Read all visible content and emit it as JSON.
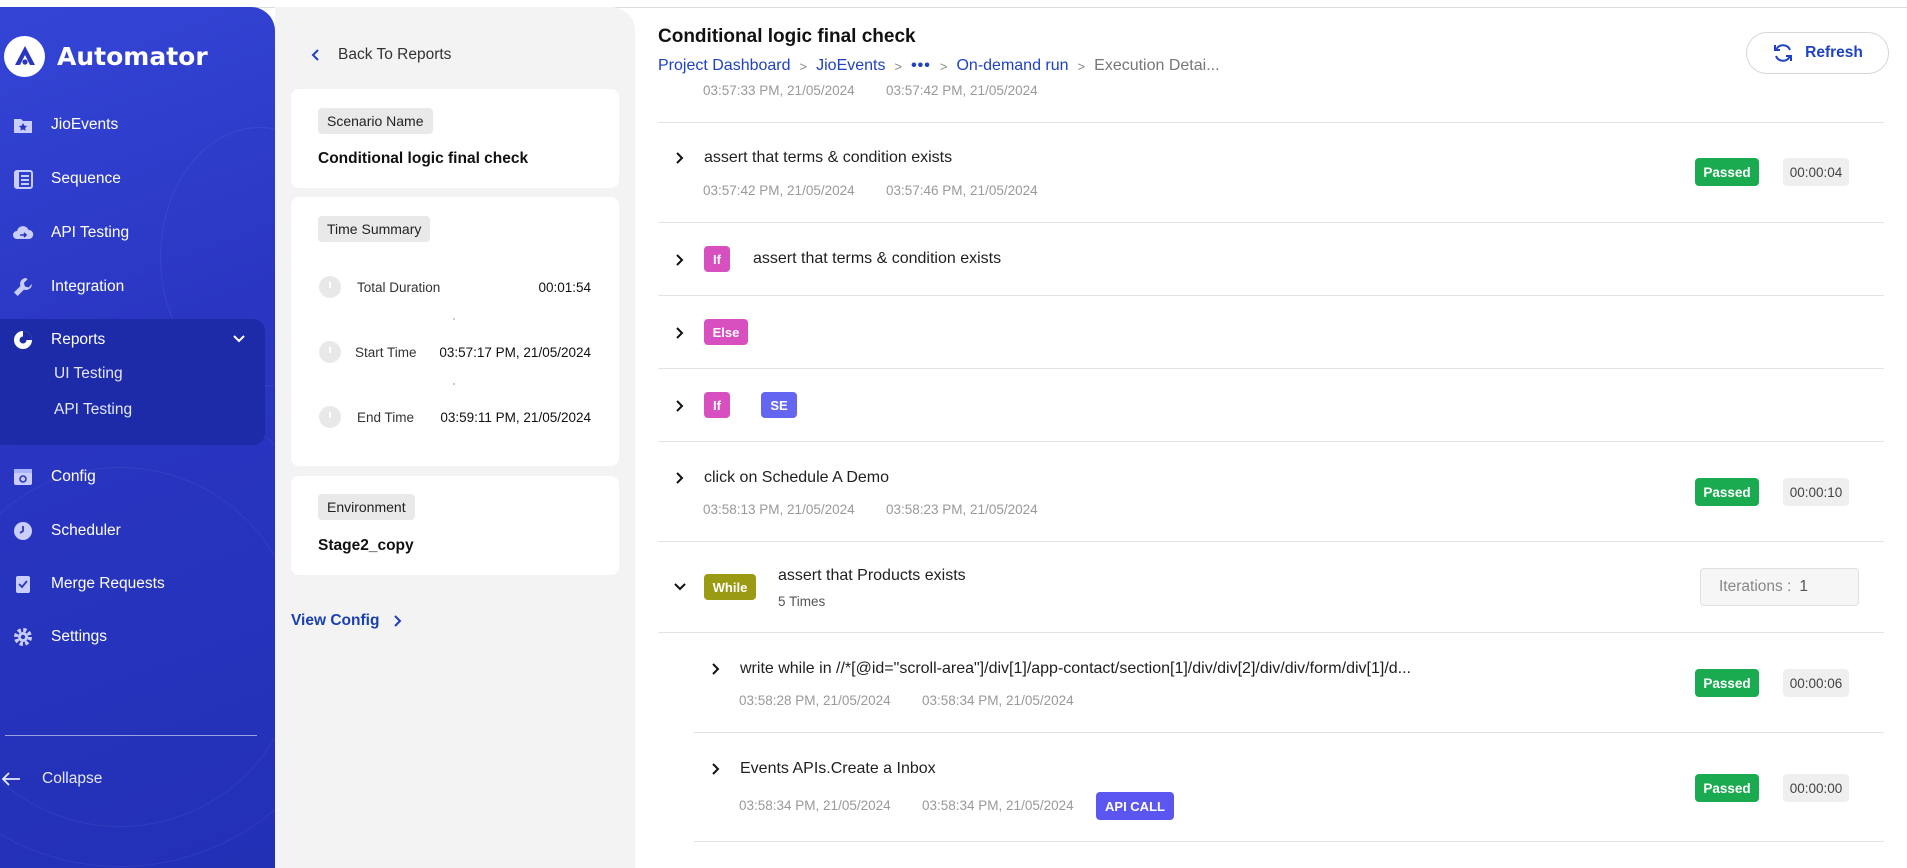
{
  "sidebar": {
    "brand": "Automator",
    "items": [
      {
        "label": "JioEvents",
        "icon": "star-folder-icon"
      },
      {
        "label": "Sequence",
        "icon": "list-icon"
      },
      {
        "label": "API Testing",
        "icon": "cloud-sync-icon"
      },
      {
        "label": "Integration",
        "icon": "wrench-icon"
      },
      {
        "label": "Reports",
        "icon": "pie-chart-icon"
      },
      {
        "label": "Config",
        "icon": "config-window-icon"
      },
      {
        "label": "Scheduler",
        "icon": "clock-icon"
      },
      {
        "label": "Merge Requests",
        "icon": "clipboard-check-icon"
      },
      {
        "label": "Settings",
        "icon": "gear-icon"
      }
    ],
    "reports_sub": [
      "UI Testing",
      "API Testing"
    ],
    "collapse": "Collapse"
  },
  "details": {
    "back": "Back To Reports",
    "scenario_tag": "Scenario Name",
    "scenario": "Conditional logic final check",
    "time_tag": "Time Summary",
    "total_label": "Total Duration",
    "total_value": "00:01:54",
    "start_label": "Start Time",
    "start_value": "03:57:17 PM, 21/05/2024",
    "end_label": "End Time",
    "end_value": "03:59:11 PM, 21/05/2024",
    "env_tag": "Environment",
    "env": "Stage2_copy",
    "view_config": "View Config"
  },
  "header": {
    "title": "Conditional logic final check",
    "crumbs": [
      "Project Dashboard",
      "JioEvents",
      "•••",
      "On-demand run",
      "Execution Detai..."
    ],
    "refresh": "Refresh"
  },
  "steps": {
    "top_start": "03:57:33 PM, 21/05/2024",
    "top_end": "03:57:42 PM, 21/05/2024",
    "s1": {
      "text": "assert that terms & condition exists",
      "start": "03:57:42 PM, 21/05/2024",
      "end": "03:57:46 PM, 21/05/2024",
      "status": "Passed",
      "dur": "00:00:04"
    },
    "if1": {
      "kw": "If",
      "text": "assert that terms & condition exists"
    },
    "else": {
      "kw": "Else"
    },
    "if2": {
      "kw": "If",
      "se": "SE"
    },
    "s2": {
      "text": "click on Schedule A Demo",
      "start": "03:58:13 PM, 21/05/2024",
      "end": "03:58:23 PM, 21/05/2024",
      "status": "Passed",
      "dur": "00:00:10"
    },
    "while": {
      "kw": "While",
      "text": "assert that Products exists",
      "times": "5 Times",
      "iter_label": "Iterations :",
      "iter_value": "1"
    },
    "s3": {
      "text": "write while in //*[@id=\"scroll-area\"]/div[1]/app-contact/section[1]/div/div[2]/div/div/form/div[1]/d...",
      "start": "03:58:28 PM, 21/05/2024",
      "end": "03:58:34 PM, 21/05/2024",
      "status": "Passed",
      "dur": "00:00:06"
    },
    "s4": {
      "text": "Events APIs.Create a Inbox",
      "start": "03:58:34 PM, 21/05/2024",
      "end": "03:58:34 PM, 21/05/2024",
      "badge": "API CALL",
      "status": "Passed",
      "dur": "00:00:00"
    }
  },
  "colors": {
    "sidebar": "#2a36c2",
    "passed": "#1aab50",
    "keyword": "#d84fbf",
    "link": "#1f42c4"
  }
}
